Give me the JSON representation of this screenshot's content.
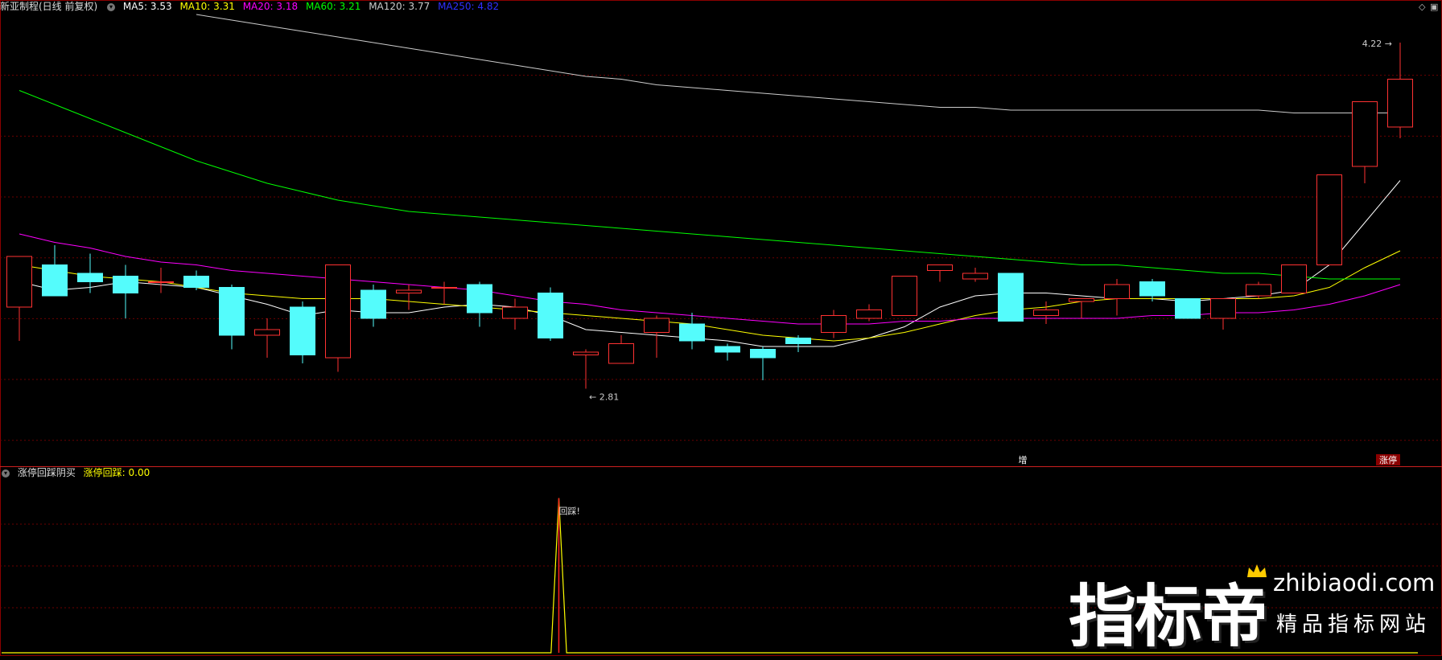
{
  "header": {
    "title": "新亚制程(日线 前复权)",
    "ma": [
      {
        "label": "MA5: 3.53",
        "color": "#ffffff"
      },
      {
        "label": "MA10: 3.31",
        "color": "#ffff00"
      },
      {
        "label": "MA20: 3.18",
        "color": "#ff00ff"
      },
      {
        "label": "MA60: 3.21",
        "color": "#00ff00"
      },
      {
        "label": "MA120: 3.77",
        "color": "#cccccc"
      },
      {
        "label": "MA250: 4.82",
        "color": "#0000ff"
      }
    ]
  },
  "sub_header": {
    "title": "涨停回踩阴买",
    "value_label": "涨停回踩: 0.00",
    "value_color": "#ffff00"
  },
  "watermark": {
    "brand": "指标帝",
    "url": "zhibiaodi.com",
    "tagline": "精品指标网站"
  },
  "chart_data": [
    {
      "type": "candlestick",
      "ylim": [
        2.72,
        4.32
      ],
      "grid": true,
      "annotations": {
        "high": "4.22",
        "low": "2.81",
        "signal_1": "增",
        "signal_2": "涨停"
      },
      "colors": {
        "up": "#ff3232",
        "down": "#54fcfc",
        "background": "#000000",
        "grid": "#8b0000"
      },
      "candles": [
        {
          "o": 3.28,
          "h": 3.41,
          "l": 3.16,
          "c": 3.46
        },
        {
          "o": 3.43,
          "h": 3.5,
          "l": 3.32,
          "c": 3.32
        },
        {
          "o": 3.4,
          "h": 3.47,
          "l": 3.33,
          "c": 3.37
        },
        {
          "o": 3.39,
          "h": 3.43,
          "l": 3.24,
          "c": 3.33
        },
        {
          "o": 3.37,
          "h": 3.42,
          "l": 3.33,
          "c": 3.37
        },
        {
          "o": 3.39,
          "h": 3.41,
          "l": 3.34,
          "c": 3.35
        },
        {
          "o": 3.35,
          "h": 3.36,
          "l": 3.13,
          "c": 3.18
        },
        {
          "o": 3.18,
          "h": 3.24,
          "l": 3.1,
          "c": 3.2
        },
        {
          "o": 3.28,
          "h": 3.3,
          "l": 3.08,
          "c": 3.11
        },
        {
          "o": 3.1,
          "h": 3.43,
          "l": 3.05,
          "c": 3.43
        },
        {
          "o": 3.34,
          "h": 3.36,
          "l": 3.21,
          "c": 3.24
        },
        {
          "o": 3.33,
          "h": 3.36,
          "l": 3.27,
          "c": 3.34
        },
        {
          "o": 3.35,
          "h": 3.37,
          "l": 3.29,
          "c": 3.35
        },
        {
          "o": 3.36,
          "h": 3.37,
          "l": 3.21,
          "c": 3.26
        },
        {
          "o": 3.24,
          "h": 3.31,
          "l": 3.2,
          "c": 3.28
        },
        {
          "o": 3.33,
          "h": 3.35,
          "l": 3.16,
          "c": 3.17
        },
        {
          "o": 3.11,
          "h": 3.13,
          "l": 2.99,
          "c": 3.12
        },
        {
          "o": 3.08,
          "h": 3.18,
          "l": 3.08,
          "c": 3.15
        },
        {
          "o": 3.19,
          "h": 3.25,
          "l": 3.1,
          "c": 3.24
        },
        {
          "o": 3.22,
          "h": 3.26,
          "l": 3.13,
          "c": 3.16
        },
        {
          "o": 3.14,
          "h": 3.15,
          "l": 3.09,
          "c": 3.12
        },
        {
          "o": 3.13,
          "h": 3.14,
          "l": 3.02,
          "c": 3.1
        },
        {
          "o": 3.17,
          "h": 3.18,
          "l": 3.12,
          "c": 3.15
        },
        {
          "o": 3.19,
          "h": 3.27,
          "l": 3.17,
          "c": 3.25
        },
        {
          "o": 3.24,
          "h": 3.29,
          "l": 3.23,
          "c": 3.27
        },
        {
          "o": 3.25,
          "h": 3.39,
          "l": 3.25,
          "c": 3.39
        },
        {
          "o": 3.41,
          "h": 3.43,
          "l": 3.37,
          "c": 3.43
        },
        {
          "o": 3.38,
          "h": 3.42,
          "l": 3.37,
          "c": 3.4
        },
        {
          "o": 3.4,
          "h": 3.4,
          "l": 3.23,
          "c": 3.23
        },
        {
          "o": 3.25,
          "h": 3.3,
          "l": 3.22,
          "c": 3.27
        },
        {
          "o": 3.3,
          "h": 3.31,
          "l": 3.24,
          "c": 3.31
        },
        {
          "o": 3.31,
          "h": 3.38,
          "l": 3.25,
          "c": 3.36
        },
        {
          "o": 3.37,
          "h": 3.38,
          "l": 3.3,
          "c": 3.32
        },
        {
          "o": 3.31,
          "h": 3.31,
          "l": 3.24,
          "c": 3.24
        },
        {
          "o": 3.24,
          "h": 3.31,
          "l": 3.2,
          "c": 3.31
        },
        {
          "o": 3.32,
          "h": 3.37,
          "l": 3.31,
          "c": 3.36
        },
        {
          "o": 3.33,
          "h": 3.43,
          "l": 3.33,
          "c": 3.43
        },
        {
          "o": 3.43,
          "h": 3.75,
          "l": 3.43,
          "c": 3.75
        },
        {
          "o": 3.78,
          "h": 4.01,
          "l": 3.72,
          "c": 4.01
        },
        {
          "o": 3.92,
          "h": 4.22,
          "l": 3.88,
          "c": 4.09
        }
      ],
      "ma_series": [
        {
          "name": "MA5",
          "color": "#ffffff",
          "values": [
            3.37,
            3.34,
            3.35,
            3.37,
            3.36,
            3.35,
            3.32,
            3.29,
            3.25,
            3.27,
            3.26,
            3.26,
            3.28,
            3.29,
            3.28,
            3.25,
            3.2,
            3.19,
            3.18,
            3.17,
            3.16,
            3.14,
            3.14,
            3.14,
            3.17,
            3.21,
            3.28,
            3.32,
            3.33,
            3.33,
            3.32,
            3.31,
            3.31,
            3.3,
            3.31,
            3.32,
            3.34,
            3.43,
            3.58,
            3.73
          ]
        },
        {
          "name": "MA10",
          "color": "#ffff00",
          "values": [
            3.43,
            3.41,
            3.39,
            3.38,
            3.37,
            3.35,
            3.33,
            3.32,
            3.31,
            3.31,
            3.31,
            3.3,
            3.29,
            3.28,
            3.27,
            3.26,
            3.25,
            3.24,
            3.23,
            3.22,
            3.2,
            3.18,
            3.17,
            3.16,
            3.17,
            3.19,
            3.22,
            3.25,
            3.27,
            3.28,
            3.3,
            3.31,
            3.31,
            3.31,
            3.31,
            3.31,
            3.32,
            3.35,
            3.42,
            3.48
          ]
        },
        {
          "name": "MA20",
          "color": "#ff00ff",
          "values": [
            3.54,
            3.51,
            3.49,
            3.46,
            3.44,
            3.43,
            3.41,
            3.4,
            3.39,
            3.38,
            3.37,
            3.36,
            3.35,
            3.34,
            3.32,
            3.3,
            3.29,
            3.27,
            3.26,
            3.25,
            3.24,
            3.23,
            3.22,
            3.22,
            3.22,
            3.23,
            3.23,
            3.24,
            3.24,
            3.24,
            3.24,
            3.24,
            3.25,
            3.25,
            3.26,
            3.26,
            3.27,
            3.29,
            3.32,
            3.36
          ]
        },
        {
          "name": "MA60",
          "color": "#00ff00",
          "values": [
            4.05,
            4.0,
            3.95,
            3.9,
            3.85,
            3.8,
            3.76,
            3.72,
            3.69,
            3.66,
            3.64,
            3.62,
            3.61,
            3.6,
            3.59,
            3.58,
            3.57,
            3.56,
            3.55,
            3.54,
            3.53,
            3.52,
            3.51,
            3.5,
            3.49,
            3.48,
            3.47,
            3.46,
            3.45,
            3.44,
            3.43,
            3.43,
            3.42,
            3.41,
            3.4,
            3.4,
            3.39,
            3.38,
            3.38,
            3.38
          ]
        },
        {
          "name": "MA120",
          "color": "#cccccc",
          "values": [
            null,
            null,
            null,
            null,
            null,
            4.32,
            4.3,
            4.28,
            4.26,
            4.24,
            4.22,
            4.2,
            4.18,
            4.16,
            4.14,
            4.12,
            4.1,
            4.09,
            4.07,
            4.06,
            4.05,
            4.04,
            4.03,
            4.02,
            4.01,
            4.0,
            3.99,
            3.99,
            3.98,
            3.98,
            3.98,
            3.98,
            3.98,
            3.98,
            3.98,
            3.98,
            3.97,
            3.97,
            3.97,
            3.97
          ]
        }
      ]
    },
    {
      "type": "line",
      "name": "涨停回踩",
      "color": "#ffff00",
      "ylim": [
        0,
        1.05
      ],
      "values": [
        0,
        0,
        0,
        0,
        0,
        0,
        0,
        0,
        0,
        0,
        0,
        0,
        0,
        0,
        0,
        0,
        0,
        0,
        0,
        0,
        0,
        0,
        0,
        0,
        0,
        0,
        0,
        0,
        0,
        0,
        0,
        0,
        0,
        0,
        0,
        0,
        0,
        0,
        0,
        0,
        0,
        0,
        0,
        0,
        0,
        0,
        0,
        0,
        0,
        0,
        0,
        0,
        0,
        0,
        0,
        0,
        0,
        0,
        0,
        0,
        0,
        0,
        0,
        0,
        0,
        0,
        0,
        0,
        0,
        0,
        0,
        0,
        1,
        0,
        0,
        0,
        0,
        0,
        0,
        0,
        0,
        0,
        0,
        0,
        0,
        0,
        0,
        0,
        0,
        0,
        0,
        0,
        0,
        0,
        0,
        0,
        0,
        0,
        0,
        0,
        0,
        0,
        0,
        0,
        0,
        0,
        0,
        0,
        0,
        0,
        0,
        0,
        0,
        0,
        0,
        0,
        0,
        0,
        0,
        0,
        0,
        0,
        0,
        0,
        0,
        0,
        0,
        0,
        0,
        0,
        0,
        0,
        0,
        0,
        0,
        0,
        0,
        0,
        0,
        0,
        0,
        0,
        0,
        0,
        0,
        0,
        0,
        0,
        0,
        0,
        0,
        0,
        0,
        0,
        0,
        0,
        0,
        0,
        0,
        0,
        0,
        0,
        0,
        0,
        0,
        0,
        0,
        0,
        0,
        0,
        0,
        0,
        0,
        0,
        0,
        0,
        0,
        0,
        0,
        0,
        0,
        0,
        0,
        0
      ],
      "annotation": "回踩!"
    }
  ]
}
